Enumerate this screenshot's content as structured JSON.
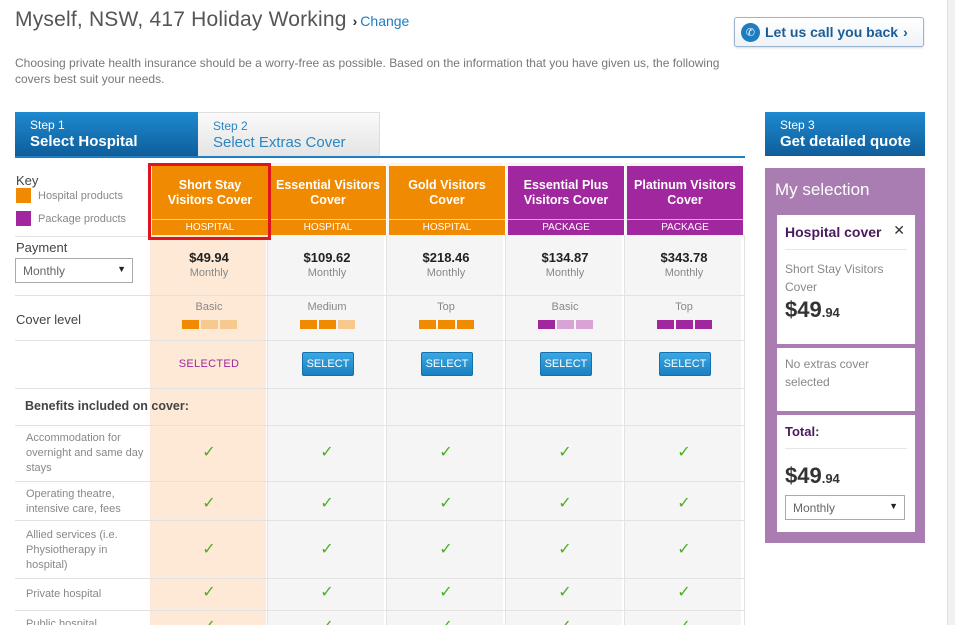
{
  "header": {
    "title": "Myself, NSW, 417 Holiday Working",
    "change_label": "Change",
    "callback_label": "Let us call you back"
  },
  "intro_text": "Choosing private health insurance should be a worry-free as possible. Based on the information that you have given us, the following covers best suit your needs.",
  "steps": [
    {
      "num": "Step 1",
      "name": "Select Hospital"
    },
    {
      "num": "Step 2",
      "name": "Select Extras Cover"
    },
    {
      "num": "Step 3",
      "name": "Get detailed quote"
    }
  ],
  "key": {
    "title": "Key",
    "hospital": "Hospital products",
    "package": "Package products"
  },
  "payment": {
    "label": "Payment",
    "value": "Monthly"
  },
  "cover_level_label": "Cover level",
  "benefits_title": "Benefits included on cover:",
  "benefits": [
    "Accommodation for overnight and same day stays",
    "Operating theatre, intensive care, fees",
    "Allied services (i.e. Physiotherapy in hospital)",
    "Private hospital",
    "Public hospital"
  ],
  "products": [
    {
      "name": "Short Stay Visitors Cover",
      "type": "HOSPITAL",
      "price": "$49.94",
      "freq": "Monthly",
      "level": "Basic",
      "level_value": 1,
      "action": "SELECTED"
    },
    {
      "name": "Essential Visitors Cover",
      "type": "HOSPITAL",
      "price": "$109.62",
      "freq": "Monthly",
      "level": "Medium",
      "level_value": 2,
      "action": "SELECT"
    },
    {
      "name": "Gold Visitors Cover",
      "type": "HOSPITAL",
      "price": "$218.46",
      "freq": "Monthly",
      "level": "Top",
      "level_value": 3,
      "action": "SELECT"
    },
    {
      "name": "Essential Plus Visitors Cover",
      "type": "PACKAGE",
      "price": "$134.87",
      "freq": "Monthly",
      "level": "Basic",
      "level_value": 1,
      "action": "SELECT"
    },
    {
      "name": "Platinum Visitors Cover",
      "type": "PACKAGE",
      "price": "$343.78",
      "freq": "Monthly",
      "level": "Top",
      "level_value": 3,
      "action": "SELECT"
    }
  ],
  "selection": {
    "title": "My selection",
    "hospital_heading": "Hospital cover",
    "hospital_product": "Short Stay Visitors Cover",
    "hospital_price_dollars": "$49",
    "hospital_price_cents": ".94",
    "extras_text": "No extras cover selected",
    "total_label": "Total:",
    "total_dollars": "$49",
    "total_cents": ".94",
    "frequency": "Monthly"
  },
  "colors": {
    "hospital": "#f08a00",
    "package": "#a0279d",
    "brand_blue": "#1e7fc2",
    "tick": "#4caf24"
  }
}
